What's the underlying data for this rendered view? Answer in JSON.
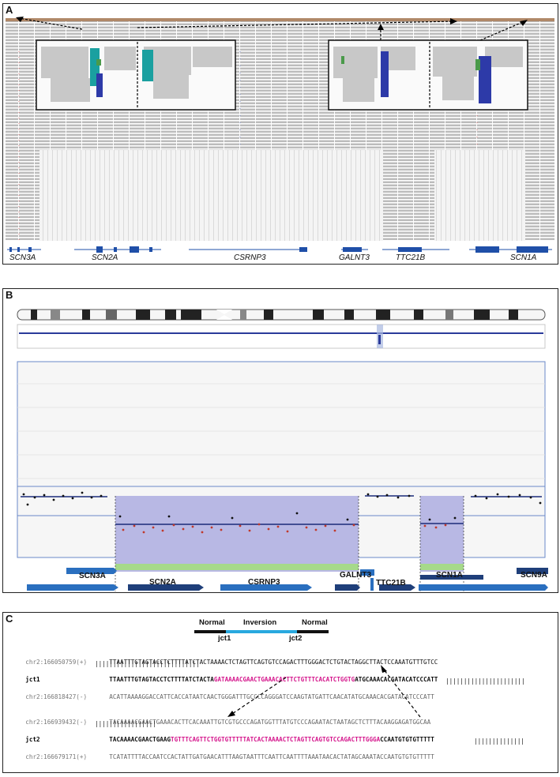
{
  "panels": {
    "a": "A",
    "b": "B",
    "c": "C"
  },
  "panel_a": {
    "genes": [
      "SCN3A",
      "SCN2A",
      "CSRNP3",
      "GALNT3",
      "TTC21B",
      "SCN1A"
    ]
  },
  "panel_b": {
    "genes": [
      "SCN3A",
      "SCN2A",
      "CSRNP3",
      "GALNT3",
      "TTC21B",
      "SCN1A",
      "SCN9A"
    ]
  },
  "panel_c": {
    "legend": {
      "normal_left": "Normal",
      "inversion": "Inversion",
      "normal_right": "Normal",
      "jct1": "jct1",
      "jct2": "jct2"
    },
    "rows": [
      {
        "label": "chr2:166050759(+)",
        "seq": "TTAATTTGTAGTACCTCTTTTATCTACTAAAACTCTAGTTCAGTGTCCAGACTTTGGGACTCTGTACTAGGCTTACTCCAAATGTTTGTCC"
      },
      {
        "label": "jct1",
        "seq_a": "TTAATTTGTAGTACCTCTTTTATCTACTA",
        "seq_m": "GATAAAACGAACTGAAACACTTCTGTTTCACATCTGGTG",
        "seq_b": "ATGCAAACACGATACATCCCATT"
      },
      {
        "label": "chr2:166818427(-)",
        "seq": "ACATTAAAAGGACCATTCACCATAATCAACTGGGATTTGCCCCAGGGATCCAAGTATGATTCAACATATGCAAACACGATACATCCCATT"
      },
      {
        "label": "chr2:166939432(-)",
        "seq": "TACAAAACGAACTGAAACACTTCACAAATTGTCGTGCCCAGATGGTTTATGTCCCAGAATACTAATAGCTCTTTACAAGGAGATGGCAA"
      },
      {
        "label": "jct2",
        "seq_a": "TACAAAACGAACTGAAG",
        "seq_m": "TGTTTCAGTTCTGGTGTTTTTATCACTAAAACTCTAGTTCAGTGTCCAGACTTTGGGA",
        "seq_b": "CCAATGTGTGTTTTT"
      },
      {
        "label": "chr2:166679171(+)",
        "seq": "TCATATTTTACCAATCCACTATTGATGAACATTTAAGTAATTTCAATTCAATTTTAAATAACACTATAGCAAATACCAATGTGTGTTTTT"
      }
    ],
    "bars1": "|||||||||||||||||||||||||||||",
    "bars1b": "||||||||||||||||||||||",
    "bars2": "|||||||||||||||||",
    "bars2b": "||||||||||||||"
  }
}
